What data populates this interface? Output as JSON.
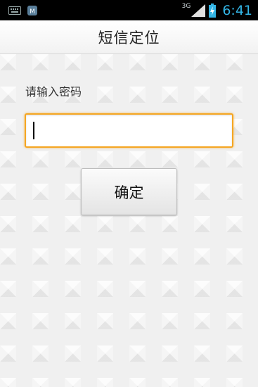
{
  "status_bar": {
    "network": "3G",
    "time": "6:41",
    "icons": [
      "keyboard-icon",
      "app-notification-icon",
      "signal-icon",
      "battery-charging-icon"
    ]
  },
  "title_bar": {
    "title": "短信定位"
  },
  "form": {
    "prompt": "请输入密码",
    "password_value": "",
    "confirm_label": "确定"
  },
  "colors": {
    "status_bar_bg": "#000000",
    "clock": "#33b5e5",
    "focus_border": "#f5a623"
  }
}
